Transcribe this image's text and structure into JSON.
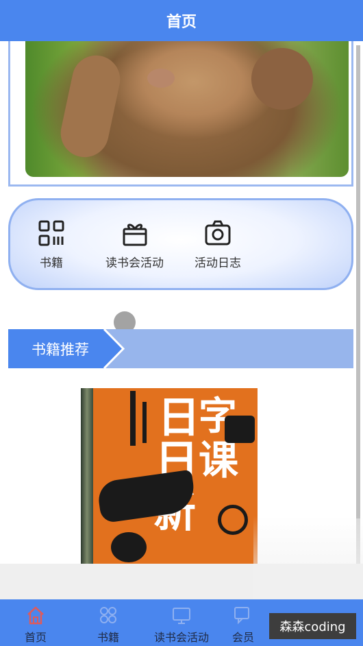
{
  "header": {
    "title": "首页"
  },
  "nav": {
    "items": [
      {
        "label": "书籍",
        "icon": "qrcode-icon"
      },
      {
        "label": "读书会活动",
        "icon": "gift-icon"
      },
      {
        "label": "活动日志",
        "icon": "camera-icon"
      }
    ]
  },
  "section": {
    "title": "书籍推荐"
  },
  "book": {
    "cover_text": [
      "日",
      "字",
      "日",
      "课",
      "新"
    ]
  },
  "tabbar": {
    "items": [
      {
        "label": "首页",
        "icon": "home-icon",
        "active": true
      },
      {
        "label": "书籍",
        "icon": "grid-icon",
        "active": false
      },
      {
        "label": "读书会活动",
        "icon": "monitor-icon",
        "active": false
      },
      {
        "label": "会员",
        "icon": "chat-icon",
        "active": false
      }
    ]
  },
  "watermark": {
    "text": "森森coding"
  },
  "colors": {
    "primary": "#4a86ee",
    "section_bar": "#97b5ec",
    "book_cover": "#e2711e",
    "home_icon_active": "#e05a5a"
  }
}
